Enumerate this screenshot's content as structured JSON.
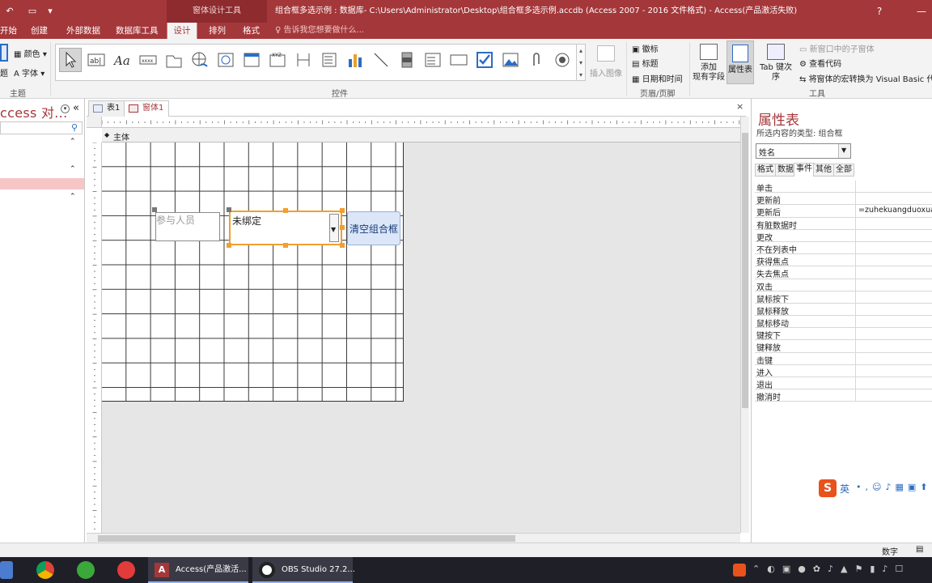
{
  "titlebar": {
    "context_tab": "窗体设计工具",
    "title": "组合框多选示例 : 数据库- C:\\Users\\Administrator\\Desktop\\组合框多选示例.accdb (Access 2007 - 2016 文件格式) - Access(产品激活失败)",
    "help": "?"
  },
  "tabs": [
    "开始",
    "创建",
    "外部数据",
    "数据库工具",
    "设计",
    "排列",
    "格式"
  ],
  "active_tab": "设计",
  "tell_me": "告诉我您想要做什么...",
  "ribbon": {
    "theme_group": {
      "label": "主题",
      "colors": "颜色",
      "fonts": "字体",
      "themes_fragment": "题"
    },
    "controls_group": {
      "label": "控件",
      "insert_image": "插入图像"
    },
    "header_footer_group": {
      "label": "页眉/页脚",
      "logo": "徽标",
      "title": "标题",
      "datetime": "日期和时间"
    },
    "tools_group": {
      "label": "工具",
      "add_fields_line1": "添加",
      "add_fields_line2": "现有字段",
      "property_sheet": "属性表",
      "tab_order": "Tab 键次序",
      "subform": "新窗口中的子窗体",
      "view_code": "查看代码",
      "convert_macros": "将窗体的宏转换为 Visual Basic 代"
    }
  },
  "nav": {
    "title": "ccess 对...",
    "chevron": "«"
  },
  "doc": {
    "tabs": [
      {
        "label": "表1"
      },
      {
        "label": "窗体1"
      }
    ],
    "section": "主体",
    "label_control": "参与人员",
    "combo_text": "未绑定",
    "button_text": "清空组合框",
    "close": "×"
  },
  "props": {
    "title": "属性表",
    "subtitle": "所选内容的类型: 组合框",
    "selected": "姓名",
    "tabs": [
      "格式",
      "数据",
      "事件",
      "其他",
      "全部"
    ],
    "active_tab": "事件",
    "rows": [
      {
        "name": "单击",
        "value": ""
      },
      {
        "name": "更新前",
        "value": ""
      },
      {
        "name": "更新后",
        "value": "=zuhekuangduoxuan"
      },
      {
        "name": "有脏数据时",
        "value": ""
      },
      {
        "name": "更改",
        "value": ""
      },
      {
        "name": "不在列表中",
        "value": ""
      },
      {
        "name": "获得焦点",
        "value": ""
      },
      {
        "name": "失去焦点",
        "value": ""
      },
      {
        "name": "双击",
        "value": ""
      },
      {
        "name": "鼠标按下",
        "value": ""
      },
      {
        "name": "鼠标释放",
        "value": ""
      },
      {
        "name": "鼠标移动",
        "value": ""
      },
      {
        "name": "键按下",
        "value": ""
      },
      {
        "name": "键释放",
        "value": ""
      },
      {
        "name": "击键",
        "value": ""
      },
      {
        "name": "进入",
        "value": ""
      },
      {
        "name": "退出",
        "value": ""
      },
      {
        "name": "撤消时",
        "value": ""
      }
    ]
  },
  "status": {
    "text": "数字"
  },
  "taskbar": {
    "access": "Access(产品激活...",
    "obs": "OBS Studio 27.2..."
  },
  "ime": {
    "mode": "英"
  },
  "colors": {
    "brand": "#a4373a",
    "selection": "#f0a030"
  }
}
